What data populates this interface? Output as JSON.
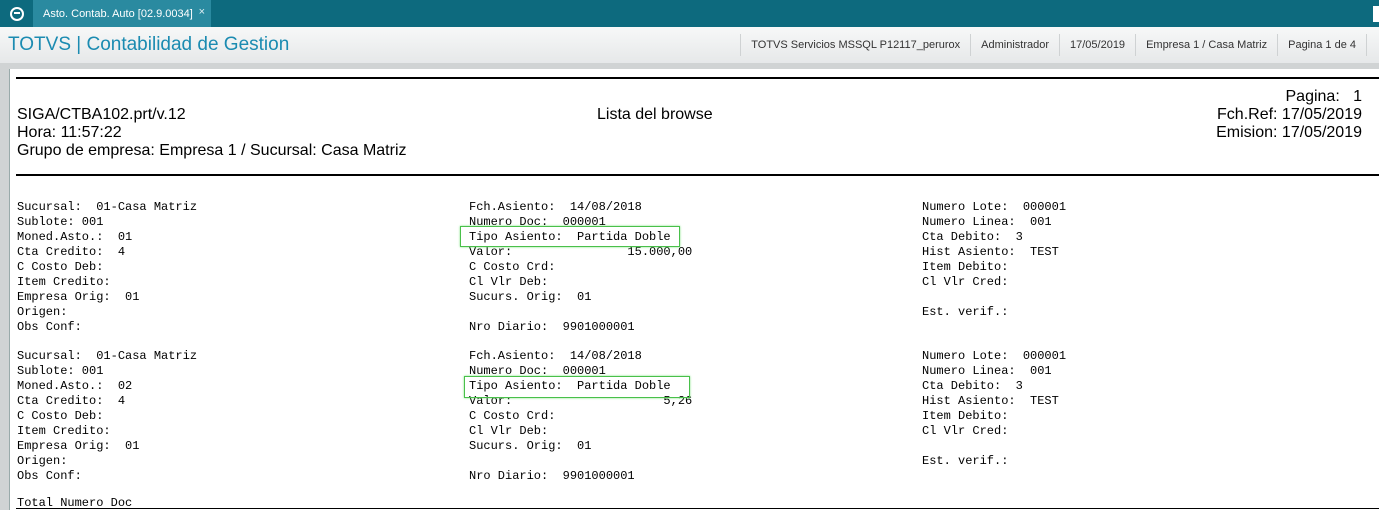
{
  "tab": {
    "title": "Asto. Contab. Auto [02.9.0034]",
    "close": "×"
  },
  "header": {
    "app_title": "TOTVS | Contabilidad de Gestion",
    "server": "TOTVS Servicios MSSQL P12117_perurox",
    "user": "Administrador",
    "date": "17/05/2019",
    "company": "Empresa 1 / Casa Matriz",
    "page": "Pagina 1 de 4"
  },
  "report": {
    "program": "SIGA/CTBA102.prt/v.12",
    "hora": "Hora: 11:57:22",
    "grupo": "Grupo de empresa: Empresa 1 / Sucursal: Casa Matriz",
    "title": "Lista del browse",
    "pagina": "Pagina:   1",
    "fchref": "Fch.Ref: 17/05/2019",
    "emision": "Emision: 17/05/2019",
    "records": [
      {
        "col1": [
          "Sucursal:  01-Casa Matriz",
          "Sublote: 001",
          "Moned.Asto.:  01",
          "Cta Credito:  4",
          "C Costo Deb:",
          "Item Credito:",
          "Empresa Orig:  01",
          "Origen:",
          "Obs Conf:"
        ],
        "col2": [
          "Fch.Asiento:  14/08/2018",
          "Numero Doc:  000001",
          "Tipo Asiento:  Partida Doble",
          "Valor:                15.000,00",
          "C Costo Crd:",
          "Cl Vlr Deb:",
          "Sucurs. Orig:  01",
          "",
          "Nro Diario:  9901000001"
        ],
        "col3": [
          "Numero Lote:  000001",
          "Numero Linea:  001",
          "Cta Debito:  3",
          "Hist Asiento:  TEST",
          "Item Debito:",
          "Cl Vlr Cred:",
          "",
          "Est. verif.:",
          ""
        ]
      },
      {
        "col1": [
          "Sucursal:  01-Casa Matriz",
          "Sublote: 001",
          "Moned.Asto.:  02",
          "Cta Credito:  4",
          "C Costo Deb:",
          "Item Credito:",
          "Empresa Orig:  01",
          "Origen:",
          "Obs Conf:"
        ],
        "col2": [
          "Fch.Asiento:  14/08/2018",
          "Numero Doc:  000001",
          "Tipo Asiento:  Partida Doble",
          "Valor:                     5,26",
          "C Costo Crd:",
          "Cl Vlr Deb:",
          "Sucurs. Orig:  01",
          "",
          "Nro Diario:  9901000001"
        ],
        "col3": [
          "Numero Lote:  000001",
          "Numero Linea:  001",
          "Cta Debito:  3",
          "Hist Asiento:  TEST",
          "Item Debito:",
          "Cl Vlr Cred:",
          "",
          "Est. verif.:",
          ""
        ]
      }
    ],
    "total": "Total Numero Doc"
  }
}
